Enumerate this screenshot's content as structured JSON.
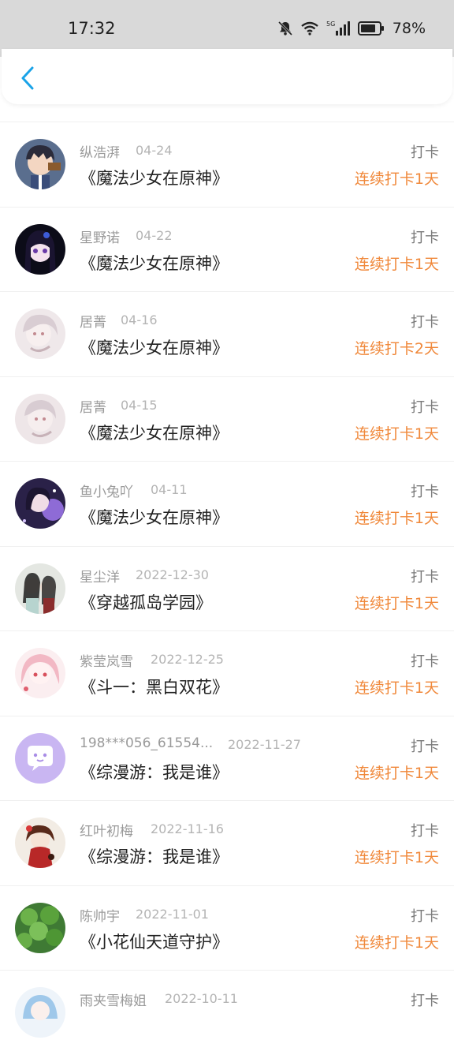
{
  "status_bar": {
    "time": "17:32",
    "battery": "78%",
    "icons": [
      "bell-muted-icon",
      "wifi-icon",
      "signal-5g-icon",
      "battery-icon"
    ]
  },
  "header": {
    "back_icon": "chevron-left-icon",
    "accent": "#1aa3e8"
  },
  "colors": {
    "streak": "#f0883a",
    "name": "#9a9a9a",
    "title": "#222222"
  },
  "checkins": [
    {
      "user": "纵浩湃",
      "date": "04-24",
      "book": "《魔法少女在原神》",
      "tag": "打卡",
      "streak": "连续打卡1天"
    },
    {
      "user": "星野诺",
      "date": "04-22",
      "book": "《魔法少女在原神》",
      "tag": "打卡",
      "streak": "连续打卡1天"
    },
    {
      "user": "居菁",
      "date": "04-16",
      "book": "《魔法少女在原神》",
      "tag": "打卡",
      "streak": "连续打卡2天"
    },
    {
      "user": "居菁",
      "date": "04-15",
      "book": "《魔法少女在原神》",
      "tag": "打卡",
      "streak": "连续打卡1天"
    },
    {
      "user": "鱼小兔吖",
      "date": "04-11",
      "book": "《魔法少女在原神》",
      "tag": "打卡",
      "streak": "连续打卡1天"
    },
    {
      "user": "星尘洋",
      "date": "2022-12-30",
      "book": "《穿越孤岛学园》",
      "tag": "打卡",
      "streak": "连续打卡1天"
    },
    {
      "user": "紫莹岚雪",
      "date": "2022-12-25",
      "book": "《斗一：黑白双花》",
      "tag": "打卡",
      "streak": "连续打卡1天"
    },
    {
      "user": "198***056_61554...",
      "date": "2022-11-27",
      "book": "《综漫游：我是谁》",
      "tag": "打卡",
      "streak": "连续打卡1天"
    },
    {
      "user": "红叶初梅",
      "date": "2022-11-16",
      "book": "《综漫游：我是谁》",
      "tag": "打卡",
      "streak": "连续打卡1天"
    },
    {
      "user": "陈帅宇",
      "date": "2022-11-01",
      "book": "《小花仙天道守护》",
      "tag": "打卡",
      "streak": "连续打卡1天"
    },
    {
      "user": "雨夹雪梅姐",
      "date": "2022-10-11",
      "book": "",
      "tag": "打卡",
      "streak": ""
    }
  ]
}
